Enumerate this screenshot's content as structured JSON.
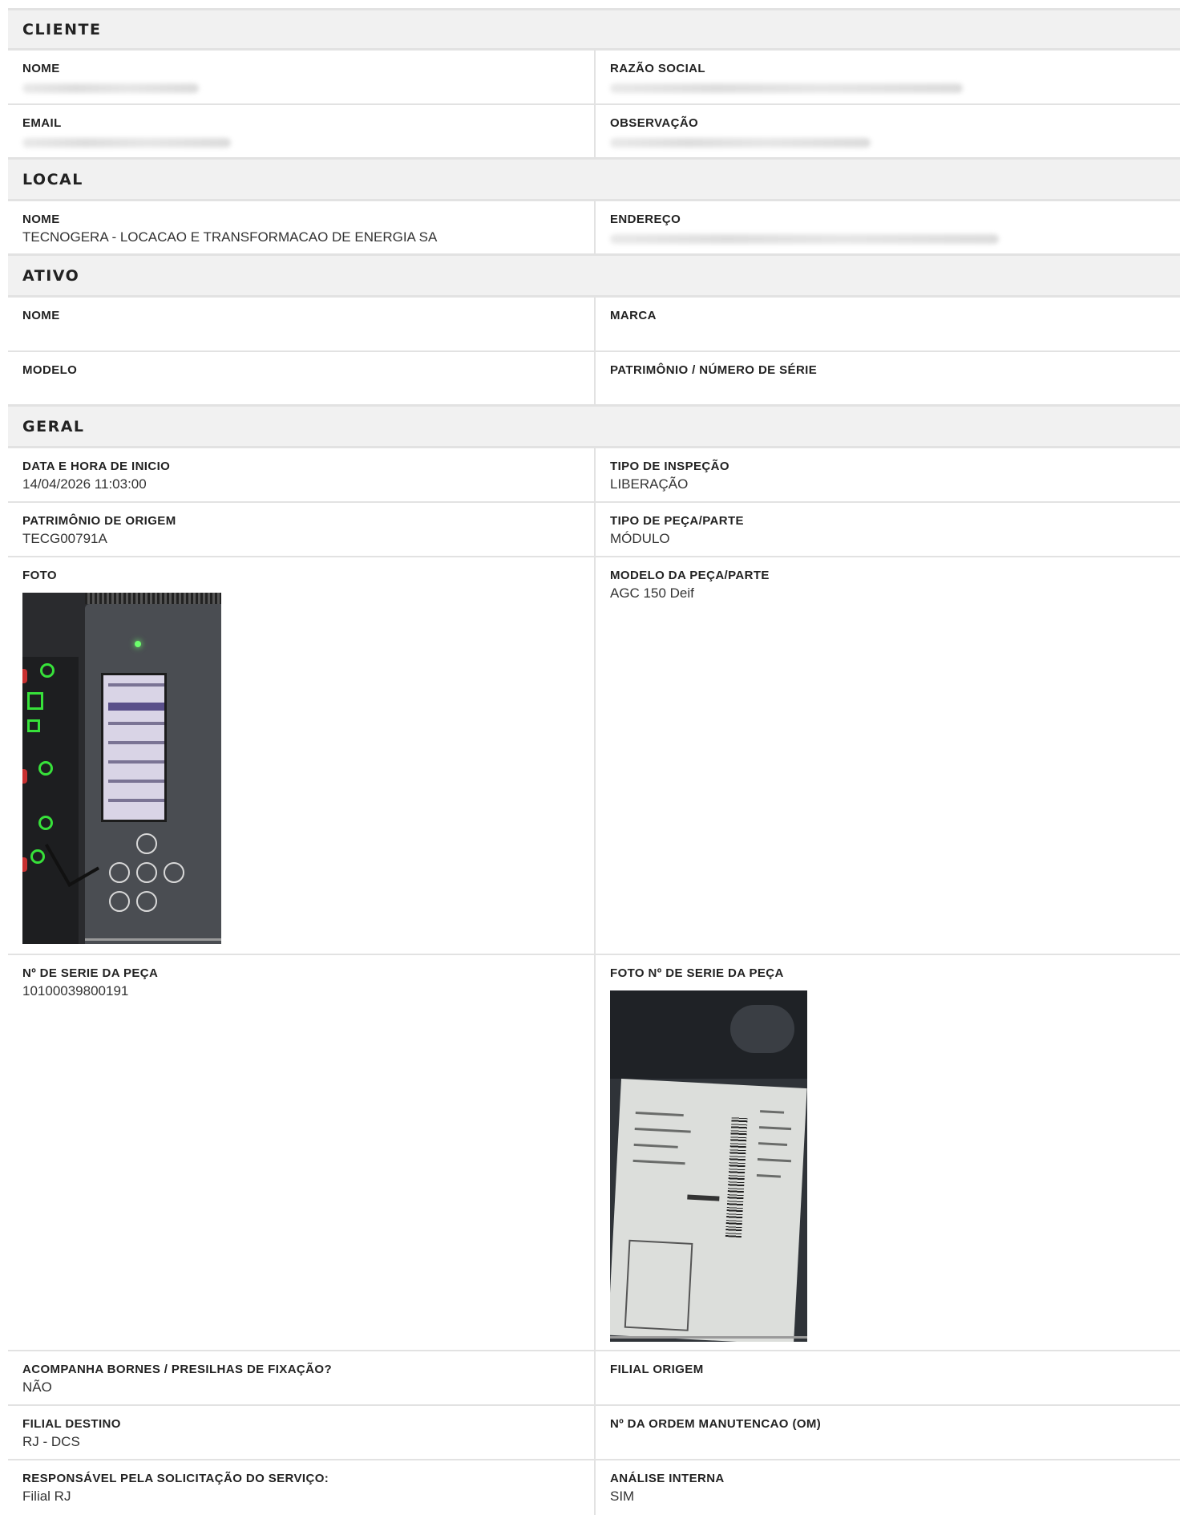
{
  "sections": {
    "cliente": {
      "title": "CLIENTE",
      "nome_label": "NOME",
      "razao_label": "RAZÃO SOCIAL",
      "email_label": "EMAIL",
      "observacao_label": "OBSERVAÇÃO"
    },
    "local": {
      "title": "LOCAL",
      "nome_label": "NOME",
      "nome_value": "TECNOGERA - LOCACAO E TRANSFORMACAO DE ENERGIA SA",
      "endereco_label": "ENDEREÇO"
    },
    "ativo": {
      "title": "ATIVO",
      "nome_label": "NOME",
      "marca_label": "MARCA",
      "modelo_label": "MODELO",
      "patrimonio_label": "PATRIMÔNIO / NÚMERO DE SÉRIE"
    },
    "geral": {
      "title": "GERAL",
      "data_label": "DATA E HORA DE INICIO",
      "data_value": "14/04/2026 11:03:00",
      "tipo_inspecao_label": "TIPO DE INSPEÇÃO",
      "tipo_inspecao_value": "LIBERAÇÃO",
      "patrimonio_origem_label": "PATRIMÔNIO DE ORIGEM",
      "patrimonio_origem_value": "TECG00791A",
      "tipo_peca_label": "TIPO DE PEÇA/PARTE",
      "tipo_peca_value": "MÓDULO",
      "foto_label": "FOTO",
      "modelo_peca_label": "MODELO DA PEÇA/PARTE",
      "modelo_peca_value": "AGC 150 Deif",
      "serie_label": "Nº DE SERIE DA PEÇA",
      "serie_value": "10100039800191",
      "foto_serie_label": "FOTO Nº DE SERIE DA PEÇA",
      "bornes_label": "ACOMPANHA BORNES / PRESILHAS DE FIXAÇÃO?",
      "bornes_value": "NÃO",
      "filial_origem_label": "FILIAL ORIGEM",
      "filial_destino_label": "FILIAL DESTINO",
      "filial_destino_value": "RJ - DCS",
      "om_label": "Nº DA ORDEM MANUTENCAO (OM)",
      "responsavel_label": "RESPONSÁVEL PELA SOLICITAÇÃO DO SERVIÇO:",
      "responsavel_value": "Filial RJ",
      "analise_label": "ANÁLISE INTERNA",
      "analise_value": "SIM"
    }
  }
}
